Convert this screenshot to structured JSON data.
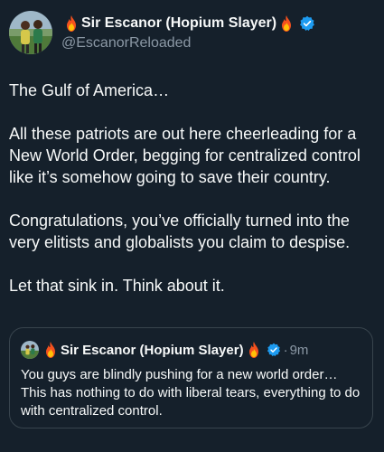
{
  "author": {
    "display_name": "Sir Escanor (Hopium Slayer)",
    "handle": "@EscanorReloaded",
    "verified": true,
    "avatar_icon": "profile-photo-icon",
    "name_emoji": "fire-icon"
  },
  "tweet": {
    "paragraphs": [
      "The Gulf of America…",
      "All these patriots are out here cheerleading for a New World Order, begging for centralized control like it’s somehow going to save their country.",
      "Congratulations, you’ve officially turned into the very elitists and globalists you claim to despise.",
      "Let that sink in. Think about it."
    ]
  },
  "quoted_tweet": {
    "display_name": "Sir Escanor (Hopium Slayer)",
    "separator": "·",
    "time": "9m",
    "text": "You guys are blindly pushing for a new world order… This has nothing to do with liberal tears, everything to do with centralized control."
  },
  "colors": {
    "background": "#15202b",
    "text": "#f7f9f9",
    "muted": "#8b98a5",
    "verified": "#1d9bf0",
    "border": "#38444d"
  }
}
